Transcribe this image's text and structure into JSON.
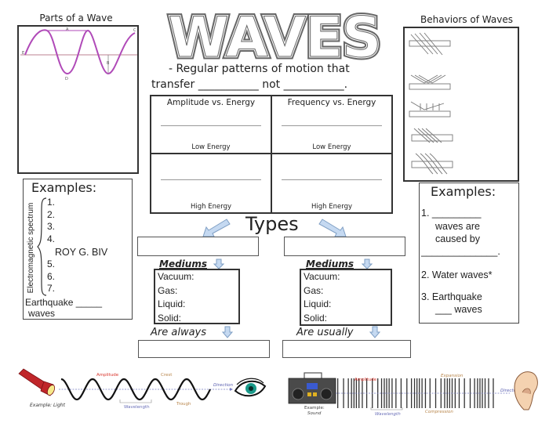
{
  "title": "WAVES",
  "definition": {
    "line1": "-  Regular patterns of motion that",
    "line2": "transfer ___________ not ___________."
  },
  "parts_of_wave": {
    "title": "Parts of a Wave",
    "labels": [
      "A",
      "B",
      "C",
      "D",
      "E"
    ]
  },
  "behaviors_of_waves": {
    "title": "Behaviors of Waves",
    "icons": [
      "transmission-icon",
      "reflection-icon",
      "absorption-icon",
      "refraction-icon",
      "diffraction-icon"
    ]
  },
  "energy_grid": {
    "columns": [
      {
        "header": "Amplitude vs. Energy",
        "low": "Low Energy",
        "high": "High Energy"
      },
      {
        "header": "Frequency vs. Energy",
        "low": "Low Energy",
        "high": "High Energy"
      }
    ]
  },
  "left_examples": {
    "title": "Examples:",
    "spectrum_label": "Electromagnetic spectrum",
    "items_top": [
      "1.",
      "2.",
      "3.",
      "4."
    ],
    "mnemonic": "ROY G. BIV",
    "items_bottom": [
      "5.",
      "6.",
      "7."
    ],
    "earthquake_line1": "Earthquake _____",
    "earthquake_line2": "waves"
  },
  "right_examples": {
    "title": "Examples:",
    "item1_a": "1. _________",
    "item1_b": "waves are",
    "item1_c": "caused by",
    "item1_d": "______________.",
    "item2": "2. Water waves*",
    "item3_a": "3. Earthquake",
    "item3_b": "___ waves"
  },
  "types": {
    "title": "Types",
    "left": {
      "mediums_label": "Mediums",
      "mediums": [
        "Vacuum:",
        "Gas:",
        "Liquid:",
        "Solid:"
      ],
      "footer_label": "Are always"
    },
    "right": {
      "mediums_label": "Mediums",
      "mediums": [
        "Vacuum:",
        "Gas:",
        "Liquid:",
        "Solid:"
      ],
      "footer_label": "Are usually"
    }
  },
  "light_diagram": {
    "example_label": "Example: Light",
    "amplitude": "Amplitude",
    "crest": "Crest",
    "trough": "Trough",
    "wavelength": "Wavelength",
    "direction": "Direction"
  },
  "sound_diagram": {
    "example_label_1": "Example:",
    "example_label_2": "Sound",
    "amplitude": "Amplitude",
    "expansion": "Expansion",
    "compression": "Compression",
    "wavelength": "Wavelength",
    "direction": "Direction"
  },
  "colors": {
    "wave_purple": "#b04ab8",
    "arrow_fill": "#c5d9f1",
    "arrow_stroke": "#7f9fc4",
    "amplitude_red": "#d9342b",
    "crest_tan": "#b8864b",
    "wavelength_blue": "#6a6fb8",
    "eye_teal": "#1a9a8a"
  }
}
